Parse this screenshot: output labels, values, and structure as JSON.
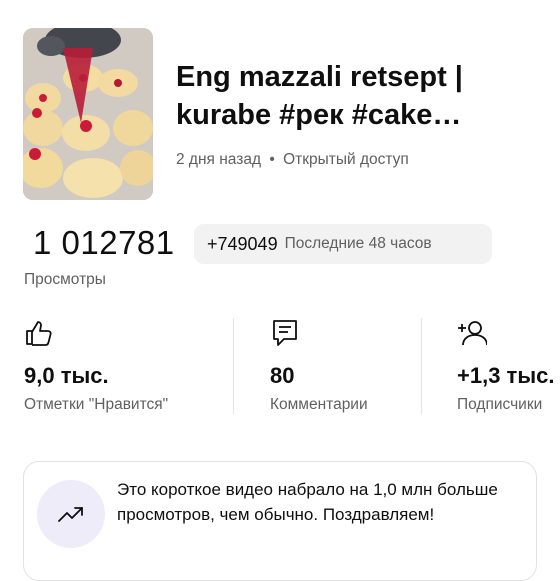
{
  "video": {
    "title_line1": "Eng mazzali retsept |",
    "title_line2": "kurabe #рек #cake…",
    "age": "2 дня назад",
    "separator": "•",
    "access": "Открытый доступ"
  },
  "views": {
    "count": "1 012781",
    "delta": "+749049",
    "delta_period": "Последние 48 часов",
    "label": "Просмотры"
  },
  "stats": [
    {
      "icon": "thumbs-up-icon",
      "value": "9,0 тыс.",
      "label": "Отметки \"Нравится\""
    },
    {
      "icon": "comment-icon",
      "value": "80",
      "label": "Комментарии"
    },
    {
      "icon": "add-subscriber-icon",
      "value": "+1,3 тыс.",
      "label": "Подписчики"
    }
  ],
  "insight": {
    "icon": "trending-up-icon",
    "text": "Это короткое видео набрало на 1,0 млн больше просмотров, чем обычно. Поздравляем!"
  },
  "colors": {
    "text_primary": "#0f0f0f",
    "text_secondary": "#606060",
    "chip_bg": "#f2f2f2",
    "insight_circle": "#eeecf8"
  }
}
